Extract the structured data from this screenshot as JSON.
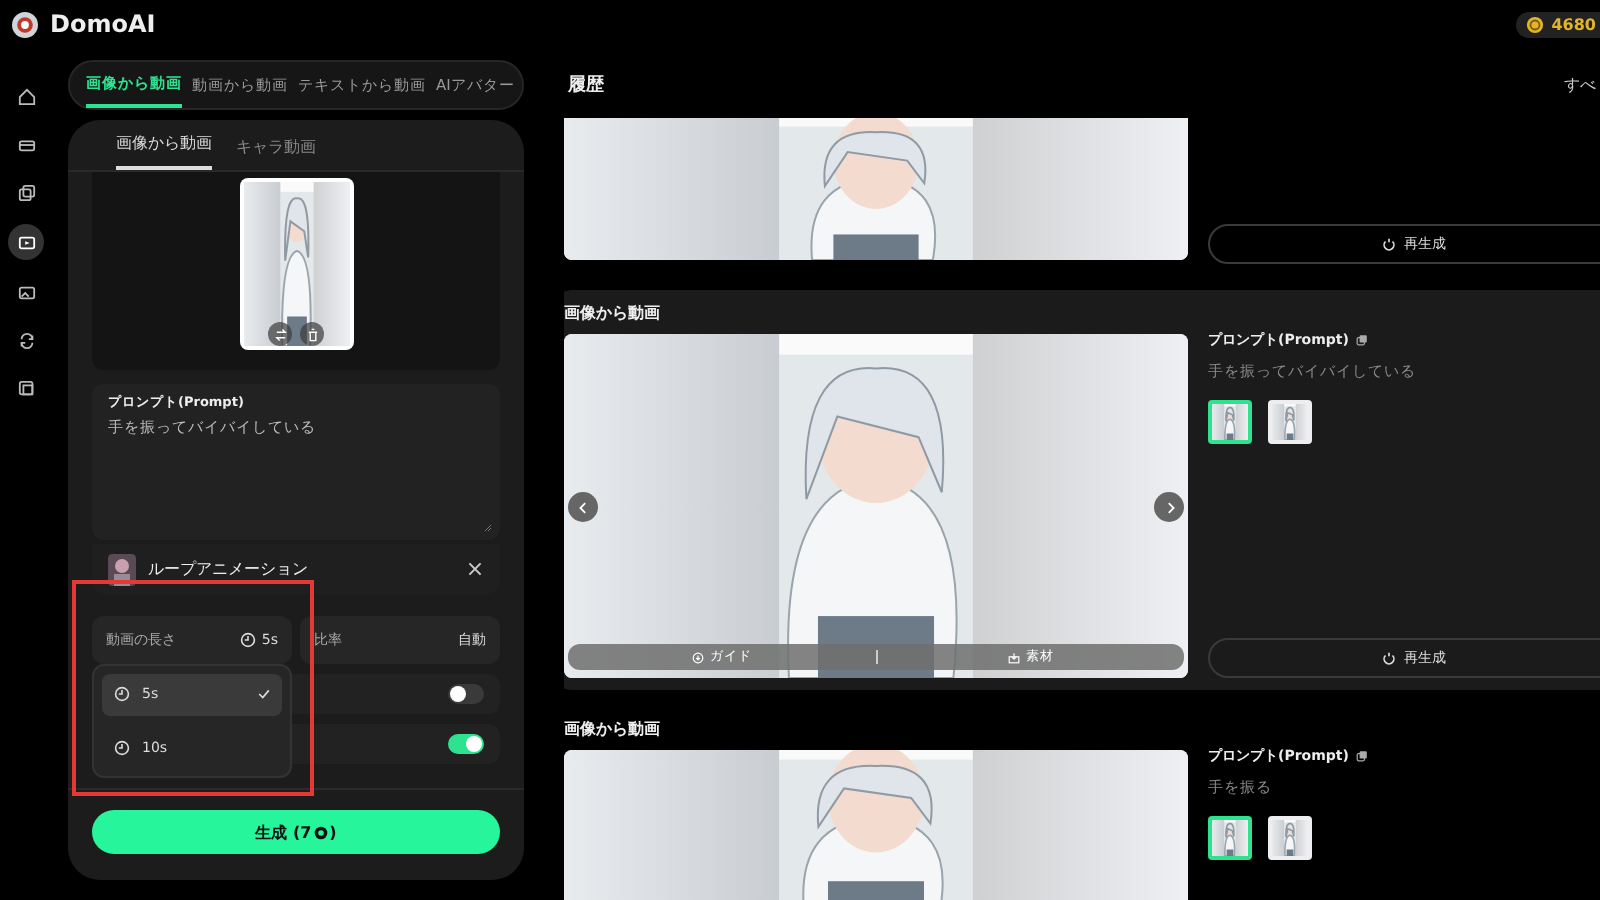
{
  "app": {
    "name": "DomoAI",
    "credits": "4680"
  },
  "nav": [
    {
      "selected": false
    },
    {
      "selected": false
    },
    {
      "selected": false
    },
    {
      "selected": true
    },
    {
      "selected": false
    },
    {
      "selected": false
    },
    {
      "selected": false
    }
  ],
  "mode_tabs": [
    {
      "label": "画像から動画",
      "selected": true
    },
    {
      "label": "動画から動画",
      "selected": false
    },
    {
      "label": "テキストから動画",
      "selected": false
    },
    {
      "label": "AIアバター",
      "selected": false
    }
  ],
  "sub_tabs": [
    {
      "label": "画像から動画",
      "selected": true
    },
    {
      "label": "キャラ動画",
      "selected": false
    }
  ],
  "prompt": {
    "label": "プロンプト(Prompt)",
    "value": "手を振ってバイバイしている"
  },
  "effect": {
    "label": "ループアニメーション"
  },
  "settings": [
    {
      "label": "動画の長さ",
      "value": "5s"
    },
    {
      "label": "比率",
      "value": "自動"
    }
  ],
  "toggles": [
    {
      "on": false
    },
    {
      "on": true
    }
  ],
  "generate": {
    "label_before": "生成 (7",
    "label_after": ")"
  },
  "duration_menu": [
    {
      "label": "5s",
      "selected": true
    },
    {
      "label": "10s",
      "selected": false
    }
  ],
  "history": {
    "title": "履歴",
    "see_all": "すべ",
    "cards": [
      {
        "highlighted": false,
        "regenerate": "再生成"
      },
      {
        "highlighted": true,
        "title": "画像から動画",
        "prompt_label": "プロンプト(Prompt)",
        "prompt": "手を振ってバイバイしている",
        "controls": [
          "ガイド",
          "素材"
        ],
        "thumbnails": [
          {
            "selected": true
          },
          {
            "selected": false
          }
        ],
        "regenerate": "再生成"
      },
      {
        "highlighted": false,
        "title": "画像から動画",
        "prompt_label": "プロンプト(Prompt)",
        "prompt": "手を振る",
        "thumbnails": [
          {
            "selected": true
          },
          {
            "selected": false
          }
        ]
      }
    ]
  }
}
